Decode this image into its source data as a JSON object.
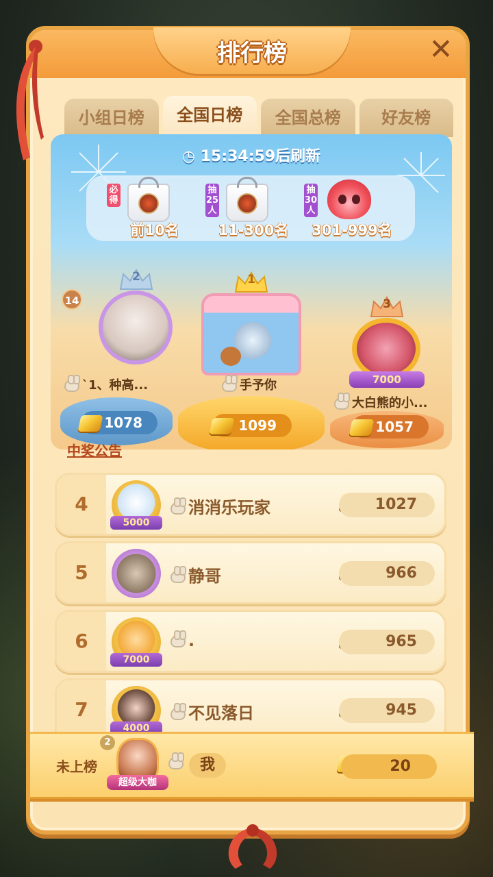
{
  "header": {
    "title": "排行榜",
    "close_icon": "close-icon"
  },
  "tabs": [
    {
      "label": "小组日榜",
      "active": false
    },
    {
      "label": "全国日榜",
      "active": true
    },
    {
      "label": "全国总榜",
      "active": false
    },
    {
      "label": "好友榜",
      "active": false
    }
  ],
  "timer": {
    "text": "15:34:59后刷新",
    "icon": "clock-icon"
  },
  "rewards": [
    {
      "tag": "必得",
      "label": "前10名",
      "tag_color": "#f0506e"
    },
    {
      "tag": "抽25人",
      "label": "11-300名",
      "tag_color": "#a24fd0"
    },
    {
      "tag": "抽30人",
      "label": "301-999名",
      "tag_color": "#a24fd0"
    }
  ],
  "podium": {
    "first": {
      "rank": "1",
      "name": "手予你",
      "score": "1099"
    },
    "second": {
      "rank": "2",
      "name": "`1、种高...",
      "score": "1078",
      "level": "14"
    },
    "third": {
      "rank": "3",
      "name": "大白熊的小...",
      "score": "1057",
      "frame_value": "7000"
    }
  },
  "notice_link": "中奖公告",
  "list": [
    {
      "rank": "4",
      "name": "消消乐玩家",
      "score": "1027",
      "frame_value": "5000"
    },
    {
      "rank": "5",
      "name": "静哥",
      "score": "966",
      "frame_value": ""
    },
    {
      "rank": "6",
      "name": ".",
      "score": "965",
      "frame_value": "7000"
    },
    {
      "rank": "7",
      "name": "不见落日",
      "score": "945",
      "frame_value": "4000"
    }
  ],
  "me": {
    "rank_label": "未上榜",
    "name": "我",
    "score": "20",
    "level": "2",
    "badge": "超级大咖"
  },
  "colors": {
    "accent": "#e9a544",
    "panel": "#fde9c0",
    "gold": "#f7c635"
  }
}
